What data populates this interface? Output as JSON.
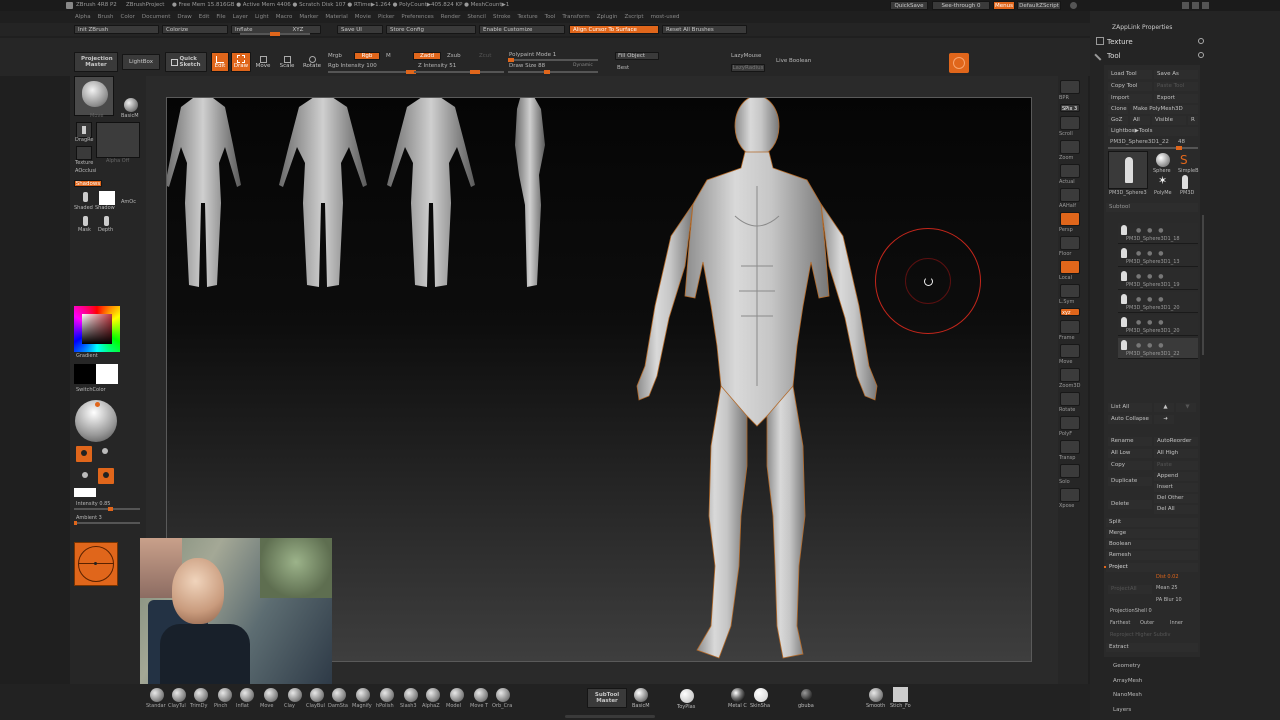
{
  "titlebar": {
    "app": "ZBrush 4R8 P2",
    "project": "ZBrushProject",
    "stats": "● Free Mem 15.816GB ● Active Mem 4406 ● Scratch Disk 107 ● RTime▶1.264 ● PolyCount▶405.824 KP ● MeshCount▶1",
    "quicksave": "QuickSave",
    "seethrough": "See-through 0",
    "menus": "Menus",
    "script": "DefaultZScript"
  },
  "menubar": [
    "Alpha",
    "Brush",
    "Color",
    "Document",
    "Draw",
    "Edit",
    "File",
    "Layer",
    "Light",
    "Macro",
    "Marker",
    "Material",
    "Movie",
    "Picker",
    "Preferences",
    "Render",
    "Stencil",
    "Stroke",
    "Texture",
    "Tool",
    "Transform",
    "Zplugin",
    "Zscript",
    "most-used"
  ],
  "row2": {
    "init": "Init ZBrush",
    "colorize": "Colorize",
    "inflate": "Inflate",
    "xyz": "XYZ",
    "saveui": "Save UI",
    "storeconfig": "Store Config",
    "enablecustomize": "Enable Customize",
    "align": "Align Cursor To Surface",
    "resetbrushes": "Reset All Brushes"
  },
  "toolbar": {
    "projection_master": "Projection Master",
    "lightbox": "LightBox",
    "quick_sketch": "Quick Sketch",
    "edit": "Edit",
    "draw": "Draw",
    "move": "Move",
    "scale": "Scale",
    "rotate": "Rotate",
    "mrgb": "Mrgb",
    "rgb": "Rgb",
    "m": "M",
    "rgb_intensity": "Rgb Intensity 100",
    "zadd": "Zadd",
    "zsub": "Zsub",
    "zcut": "Zcut",
    "z_intensity": "Z Intensity 51",
    "polypaint_mode": "Polypaint Mode 1",
    "draw_size": "Draw Size 88",
    "dynamic": "Dynamic",
    "fill_object": "Fill Object",
    "best": "Best",
    "lazymouse": "LazyMouse",
    "lazyradius": "LazyRadius",
    "live_boolean": "Live Boolean"
  },
  "left": {
    "brush_label": "Move",
    "basic": "BasicM",
    "dragrect": "DragRe",
    "alpha_off": "Alpha Off",
    "texture_off": "Texture",
    "aocclusion": "AOcclusi",
    "shadows": "Shadows",
    "shaded": "Shaded",
    "shadow": "Shadow",
    "amoc": "AmOc",
    "mask": "Mask",
    "depth": "Depth",
    "gradient": "Gradient",
    "switchcolor": "SwitchColor",
    "intensity": "Intensity 0.85",
    "ambient": "Ambient 3"
  },
  "right_icons": [
    "BPR",
    "SPix 3",
    "Scroll",
    "Zoom",
    "Actual",
    "AAHalf",
    "Persp",
    "Floor",
    "Local",
    "L.Sym",
    "xyz",
    "Frame",
    "Move",
    "Zoom3D",
    "Rotate",
    "PolyF",
    "Transp",
    "Solo",
    "Xpose"
  ],
  "rightpanel": {
    "zapplink": "ZAppLink Properties",
    "texture": "Texture",
    "tool": "Tool",
    "load_tool": "Load Tool",
    "save_as": "Save As",
    "copy_tool": "Copy Tool",
    "paste_tool": "Paste Tool",
    "import": "Import",
    "export": "Export",
    "clone": "Clone",
    "make_polymesh": "Make PolyMesh3D",
    "goz": "GoZ",
    "all": "All",
    "visible": "Visible",
    "r": "R",
    "lightbox_tools": "Lightbox▶Tools",
    "current_tool": "PM3D_Sphere3D1_22",
    "current_value": "48",
    "tool_thumbs": [
      "PM3D_Sphere3",
      "Sphere",
      "SimpleB",
      "PolyMe",
      "PM3D"
    ],
    "subtool": "Subtool",
    "subtools": [
      "PM3D_Sphere3D1_18",
      "PM3D_Sphere3D1_13",
      "PM3D_Sphere3D1_19",
      "PM3D_Sphere3D1_20",
      "PM3D_Sphere3D1_20",
      "PM3D_Sphere3D1_22"
    ],
    "list_all": "List All",
    "auto_collapse": "Auto Collapse",
    "rename": "Rename",
    "autoreorder": "AutoReorder",
    "all_low": "All Low",
    "all_high": "All High",
    "copy": "Copy",
    "paste": "Paste",
    "append": "Append",
    "duplicate": "Duplicate",
    "insert": "Insert",
    "delete": "Delete",
    "del_other": "Del Other",
    "del_all": "Del All",
    "split": "Split",
    "merge": "Merge",
    "boolean": "Boolean",
    "remesh": "Remesh",
    "project": "Project",
    "dist": "Dist 0.02",
    "projectall": "ProjectAll",
    "mean": "Mean 25",
    "pa_blur": "PA Blur 10",
    "projection_shell": "ProjectionShell 0",
    "farthest": "Farthest",
    "outer": "Outer",
    "inner": "Inner",
    "reproject": "Reproject Higher Subdiv",
    "extract": "Extract",
    "geometry": "Geometry",
    "arraymesh": "ArrayMesh",
    "nanomesh": "NanoMesh",
    "layers": "Layers"
  },
  "bottom": {
    "brushes": [
      "Standar",
      "ClayTul",
      "TrimDy",
      "Pinch",
      "Inflat",
      "Move",
      "Clay",
      "ClayBul",
      "DamSta",
      "Magnify",
      "hPolish",
      "Slash3",
      "AlphaZ",
      "Model",
      "Move T",
      "Orb_Cra"
    ],
    "subtool_master": "SubTool Master",
    "basicm": "BasicM",
    "toyplast": "ToyPlas",
    "metal": "Metal C",
    "skinsha": "SkinSha",
    "gbuba": "gbuba",
    "smooth": "Smooth",
    "stitch": "Stich_Fo"
  },
  "colors": {
    "accent": "#e0661b",
    "bg": "#1f1f1f",
    "panel": "#2a2a2a"
  }
}
